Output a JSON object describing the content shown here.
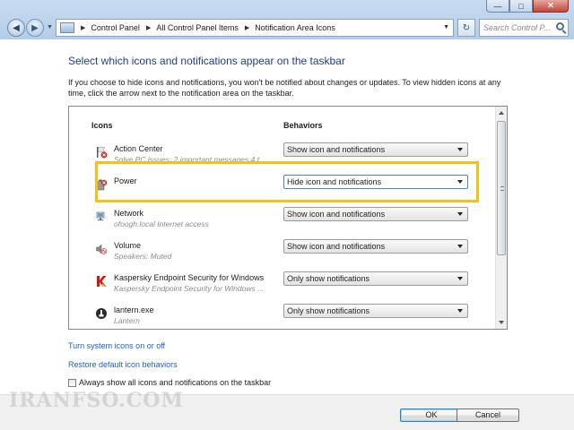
{
  "window": {
    "caption_buttons": {
      "min": "—",
      "max": "□",
      "close": "✕"
    }
  },
  "address_bar": {
    "breadcrumbs": [
      {
        "label": "Control Panel"
      },
      {
        "label": "All Control Panel Items"
      },
      {
        "label": "Notification Area Icons"
      }
    ],
    "search_placeholder": "Search Control P..."
  },
  "main": {
    "heading": "Select which icons and notifications appear on the taskbar",
    "intro": "If you choose to hide icons and notifications, you won't be notified about changes or updates. To view hidden icons at any time, click the arrow next to the notification area on the taskbar.",
    "columns": {
      "icons": "Icons",
      "behaviors": "Behaviors"
    },
    "rows": [
      {
        "name": "Action Center",
        "subtitle": "Solve PC issues: 2 important messages 4 t...",
        "behavior": "Show icon and notifications",
        "icon": "action-center-flag-icon"
      },
      {
        "name": "Power",
        "subtitle": "",
        "behavior": "Hide icon and notifications",
        "icon": "power-battery-icon"
      },
      {
        "name": "Network",
        "subtitle": "ofoogh.local Internet access",
        "behavior": "Show icon and notifications",
        "icon": "network-icon"
      },
      {
        "name": "Volume",
        "subtitle": "Speakers: Muted",
        "behavior": "Show icon and notifications",
        "icon": "volume-muted-icon"
      },
      {
        "name": "Kaspersky Endpoint Security for Windows",
        "subtitle": "Kaspersky Endpoint Security for Windows ...",
        "behavior": "Only show notifications",
        "icon": "kaspersky-icon"
      },
      {
        "name": "lantern.exe",
        "subtitle": "Lantern",
        "behavior": "Only show notifications",
        "icon": "lantern-icon"
      }
    ],
    "links": {
      "system_icons": "Turn system icons on or off",
      "restore": "Restore default icon behaviors"
    },
    "always_show": {
      "label": "Always show all icons and notifications on the taskbar",
      "checked": false
    }
  },
  "footer": {
    "ok": "OK",
    "cancel": "Cancel"
  },
  "watermark": "IRANFSO.COM",
  "colors": {
    "heading": "#1e3c8a",
    "link": "#1e62c8",
    "highlight": "#f2c21b"
  }
}
